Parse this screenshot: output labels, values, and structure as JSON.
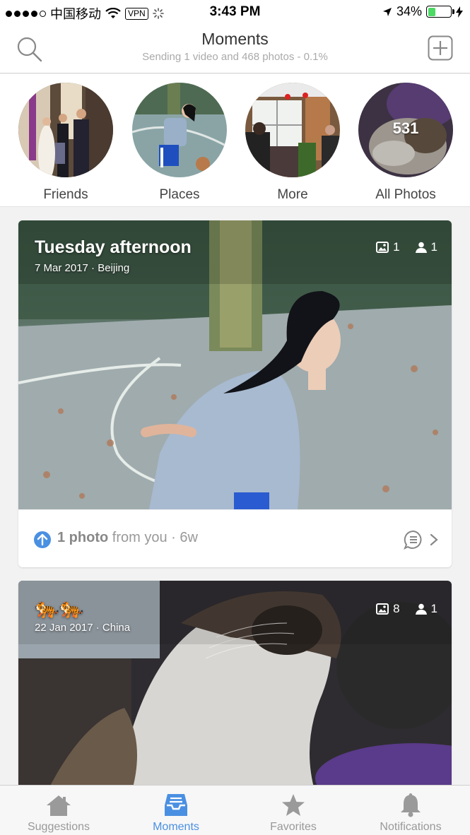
{
  "status_bar": {
    "carrier": "中国移动",
    "vpn": "VPN",
    "time": "3:43 PM",
    "battery": "34%",
    "battery_level": 0.34
  },
  "header": {
    "title": "Moments",
    "subtitle": "Sending 1 video and 468 photos - 0.1%"
  },
  "albums": [
    {
      "label": "Friends"
    },
    {
      "label": "Places"
    },
    {
      "label": "More"
    },
    {
      "label": "All Photos",
      "count": "531"
    }
  ],
  "cards": [
    {
      "title": "Tuesday afternoon",
      "date": "7 Mar 2017 · Beijing",
      "photos": "1",
      "people": "1",
      "footer_count": "1 photo",
      "footer_rest": " from you · 6w"
    },
    {
      "title": "🐅🐅",
      "date": "22 Jan 2017 · China",
      "photos": "8",
      "people": "1"
    }
  ],
  "tabs": [
    {
      "label": "Suggestions",
      "icon": "home-icon"
    },
    {
      "label": "Moments",
      "icon": "inbox-icon"
    },
    {
      "label": "Favorites",
      "icon": "star-icon"
    },
    {
      "label": "Notifications",
      "icon": "bell-icon"
    }
  ],
  "colors": {
    "accent": "#4a90e2",
    "battery": "#4cd964",
    "inactive": "#999999"
  }
}
